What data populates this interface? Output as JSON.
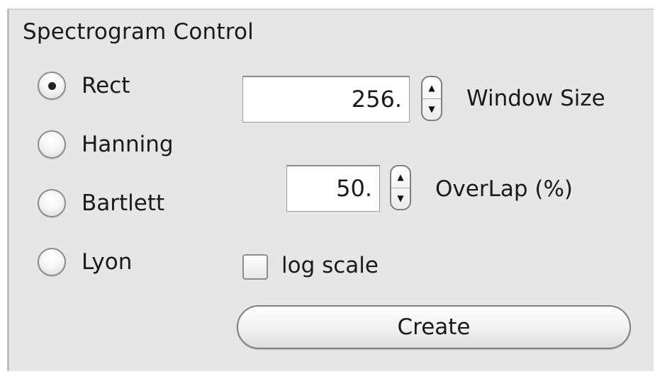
{
  "panel": {
    "title": "Spectrogram Control"
  },
  "window_type": {
    "selected": "Rect",
    "options": [
      {
        "label": "Rect",
        "selected": true
      },
      {
        "label": "Hanning",
        "selected": false
      },
      {
        "label": "Bartlett",
        "selected": false
      },
      {
        "label": "Lyon",
        "selected": false
      }
    ]
  },
  "window_size": {
    "value": "256.",
    "label": "Window Size"
  },
  "overlap": {
    "value": "50.",
    "label": "OverLap (%)"
  },
  "log_scale": {
    "label": "log scale",
    "checked": false
  },
  "actions": {
    "create_label": "Create"
  },
  "icons": {
    "stepper_up": "triangle-up-icon",
    "stepper_down": "triangle-down-icon"
  }
}
